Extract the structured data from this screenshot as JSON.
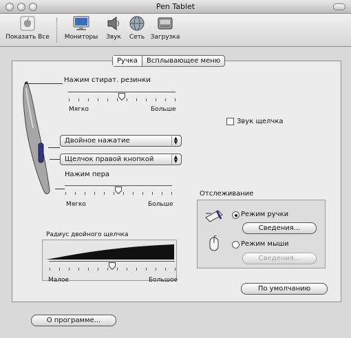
{
  "window": {
    "title": "Pen Tablet"
  },
  "toolbar": {
    "items": [
      {
        "label": "Показать Все",
        "icon": "apple-icon"
      },
      {
        "label": "Мониторы",
        "icon": "monitor-icon"
      },
      {
        "label": "Звук",
        "icon": "speaker-icon"
      },
      {
        "label": "Сеть",
        "icon": "network-globe-icon"
      },
      {
        "label": "Загрузка",
        "icon": "startup-disk-icon"
      }
    ]
  },
  "tabs": [
    {
      "label": "Ручка",
      "selected": true
    },
    {
      "label": "Всплывающее меню",
      "selected": false
    }
  ],
  "eraser": {
    "label": "Нажим стират. резинки",
    "min_label": "Мягко",
    "max_label": "Больше",
    "value_fraction": 0.5
  },
  "side_switches": {
    "upper": "Двойное нажатие",
    "lower": "Щелчок правой кнопкой"
  },
  "tip": {
    "label": "Нажим пера",
    "min_label": "Мягко",
    "max_label": "Больше",
    "value_fraction": 0.5
  },
  "click_sound": {
    "label": "Звук щелчка",
    "checked": false
  },
  "double_click": {
    "label": "Радиус двойного щелчка",
    "min_label": "Малое",
    "max_label": "Большое",
    "value_fraction": 0.5
  },
  "tracking": {
    "label": "Отслеживание",
    "pen_mode": {
      "label": "Режим ручки",
      "selected": true,
      "details_label": "Сведения..."
    },
    "mouse_mode": {
      "label": "Режим мыши",
      "selected": false,
      "details_label": "Сведения..."
    }
  },
  "defaults_button": "По умолчанию",
  "about_button": "О программе..."
}
